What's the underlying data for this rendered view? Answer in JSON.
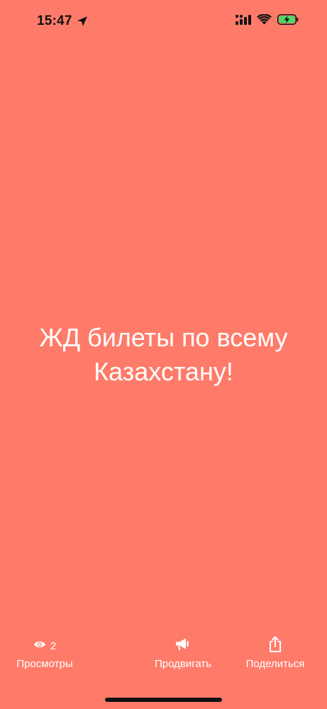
{
  "status_bar": {
    "time": "15:47",
    "icons": [
      "location-arrow-icon",
      "cellular-signal-icon",
      "wifi-icon",
      "battery-charging-icon"
    ],
    "battery_color": "#4CD964"
  },
  "story": {
    "background_color": "#FF7B69",
    "text_line1": "ЖД билеты по всему",
    "text_line2": "Казахстану!"
  },
  "actions": {
    "views": {
      "icon": "eye-icon",
      "count": "2",
      "label": "Просмотры"
    },
    "promote": {
      "icon": "megaphone-icon",
      "label": "Продвигать"
    },
    "share": {
      "icon": "share-icon",
      "label": "Поделиться"
    }
  }
}
